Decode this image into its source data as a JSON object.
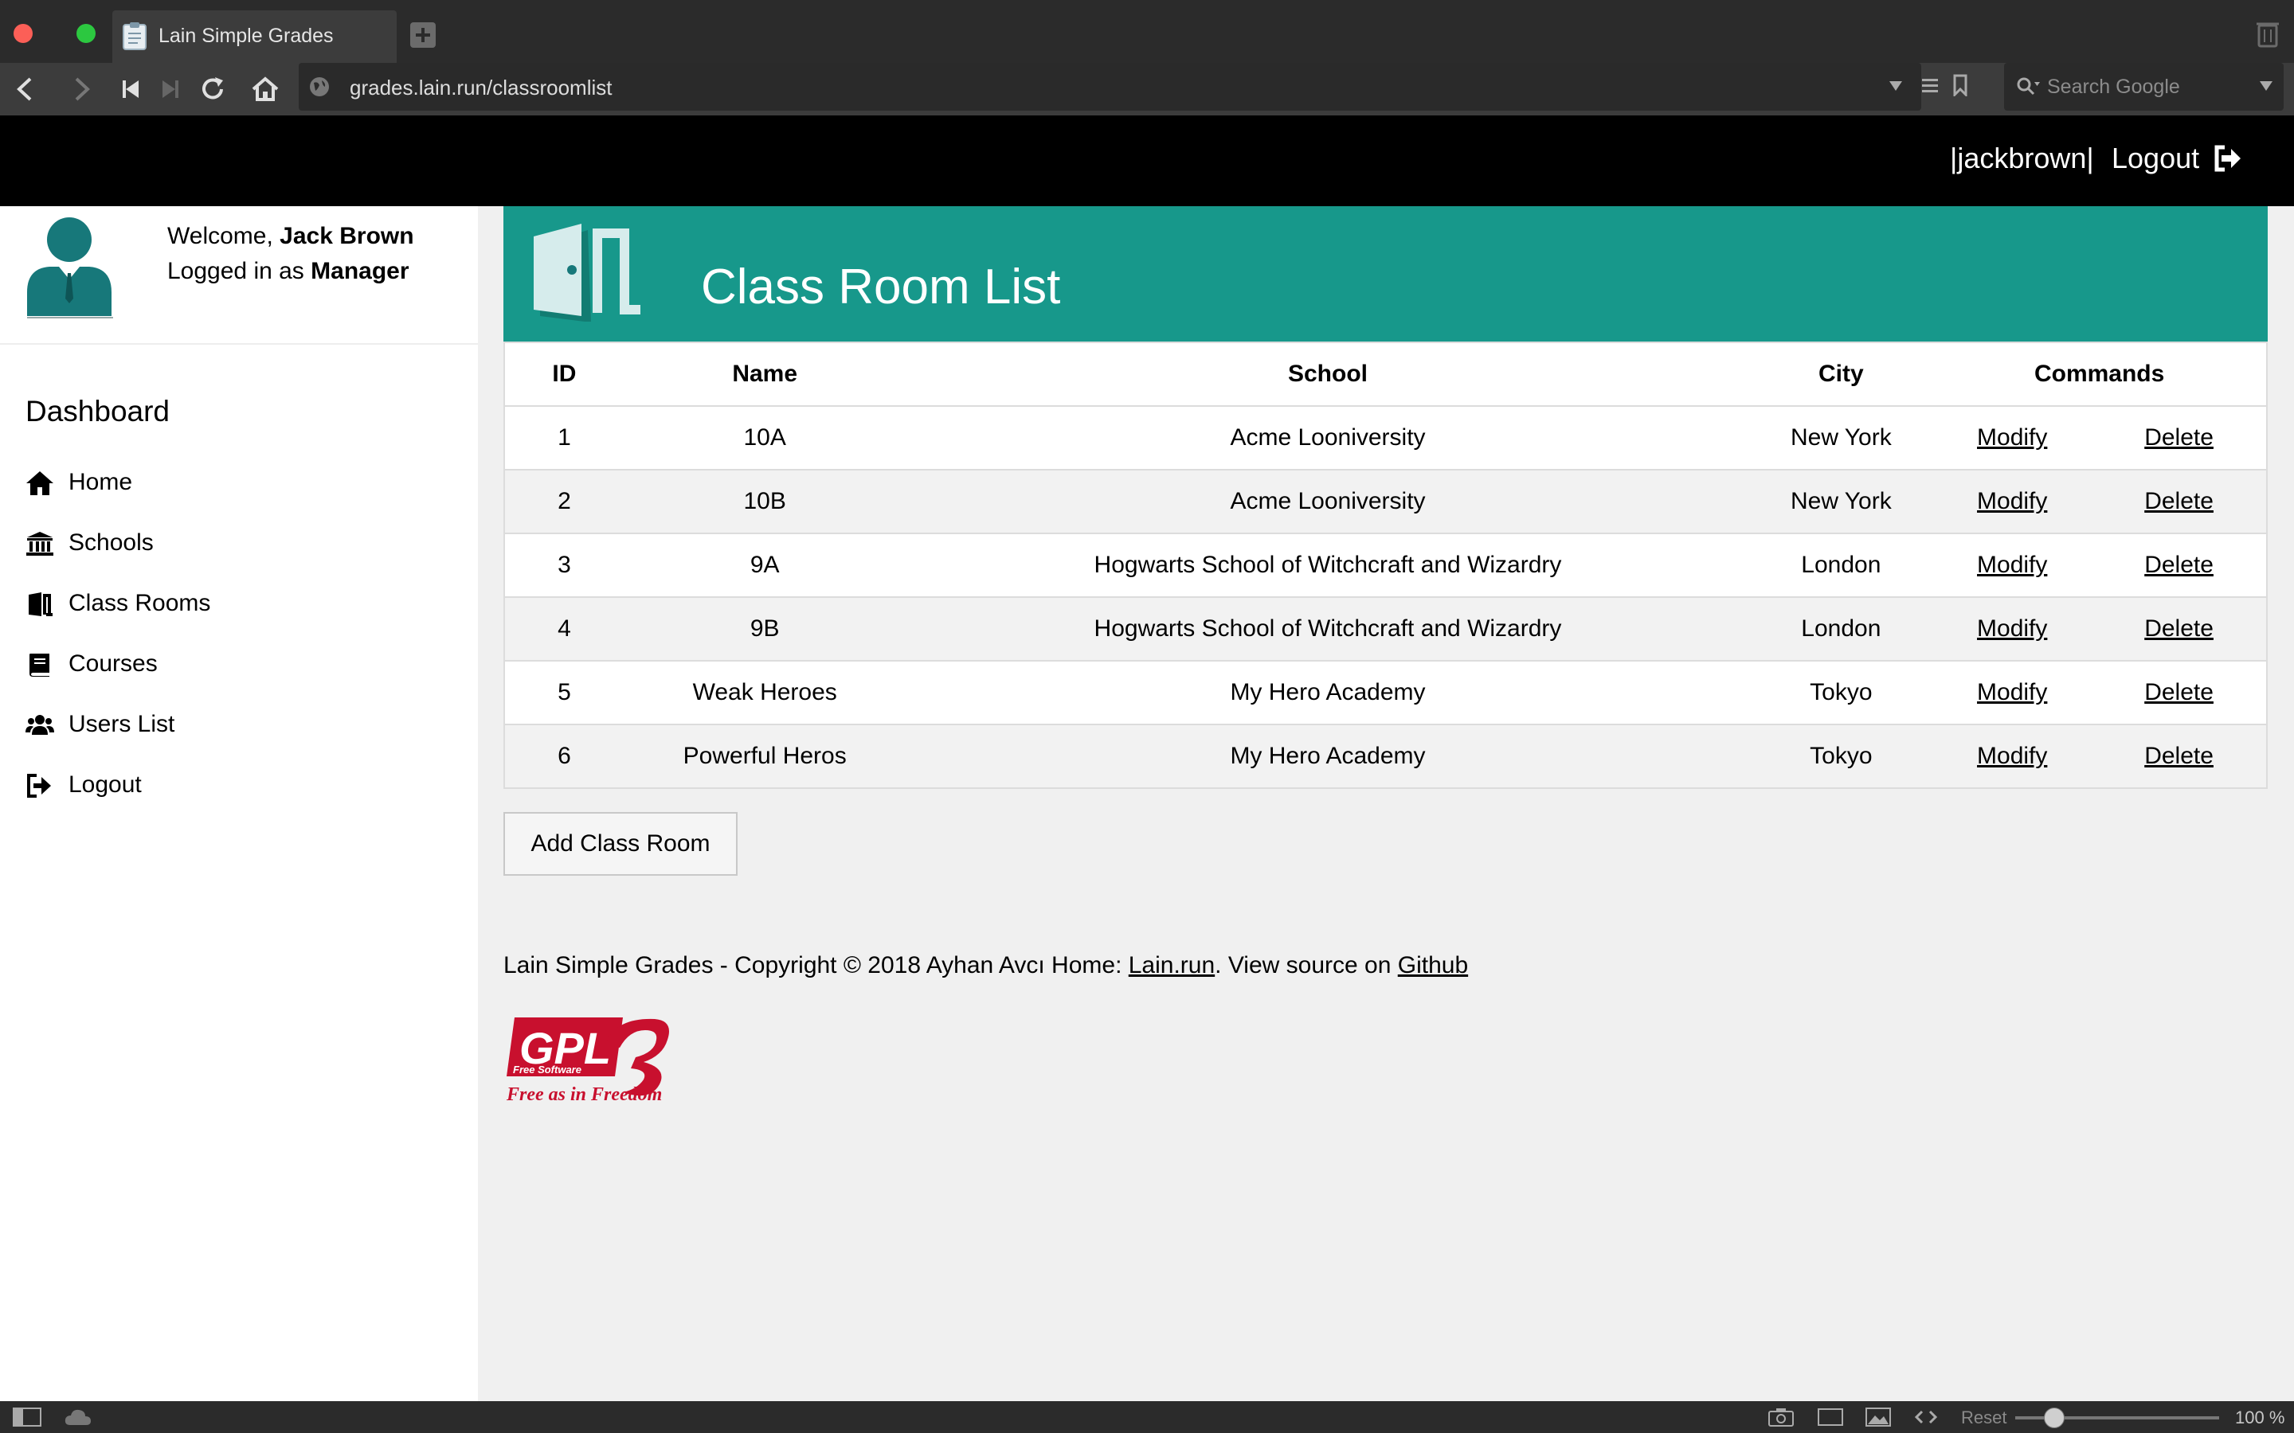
{
  "browser": {
    "tab_title": "Lain Simple Grades",
    "url": "grades.lain.run/classroomlist",
    "search_placeholder": "Search Google",
    "zoom_reset": "Reset",
    "zoom_level": "100 %"
  },
  "topbar": {
    "username": "|jackbrown|",
    "logout": "Logout"
  },
  "sidebar": {
    "welcome_prefix": "Welcome, ",
    "user_name": "Jack Brown",
    "logged_prefix": "Logged in as ",
    "role": "Manager",
    "title": "Dashboard",
    "items": [
      {
        "label": "Home",
        "icon": "home-icon"
      },
      {
        "label": "Schools",
        "icon": "school-icon"
      },
      {
        "label": "Class Rooms",
        "icon": "door-icon"
      },
      {
        "label": "Courses",
        "icon": "book-icon"
      },
      {
        "label": "Users List",
        "icon": "users-icon"
      },
      {
        "label": "Logout",
        "icon": "logout-icon"
      }
    ]
  },
  "header": {
    "title": "Class Room List",
    "color": "#17988b"
  },
  "table": {
    "columns": [
      "ID",
      "Name",
      "School",
      "City",
      "Commands"
    ],
    "modify_label": "Modify",
    "delete_label": "Delete",
    "rows": [
      {
        "id": "1",
        "name": "10A",
        "school": "Acme Looniversity",
        "city": "New York"
      },
      {
        "id": "2",
        "name": "10B",
        "school": "Acme Looniversity",
        "city": "New York"
      },
      {
        "id": "3",
        "name": "9A",
        "school": "Hogwarts School of Witchcraft and Wizardry",
        "city": "London"
      },
      {
        "id": "4",
        "name": "9B",
        "school": "Hogwarts School of Witchcraft and Wizardry",
        "city": "London"
      },
      {
        "id": "5",
        "name": "Weak Heroes",
        "school": "My Hero Academy",
        "city": "Tokyo"
      },
      {
        "id": "6",
        "name": "Powerful Heros",
        "school": "My Hero Academy",
        "city": "Tokyo"
      }
    ]
  },
  "add_button": "Add Class Room",
  "footer": {
    "text1": "Lain Simple Grades - Copyright © 2018 Ayhan Avcı Home: ",
    "link1": "Lain.run",
    "text2": ". View source on ",
    "link2": "Github"
  },
  "gpl": {
    "logo_text": "GPL",
    "version": "3",
    "small": "Free Software",
    "slogan": "Free as in Freedom"
  }
}
